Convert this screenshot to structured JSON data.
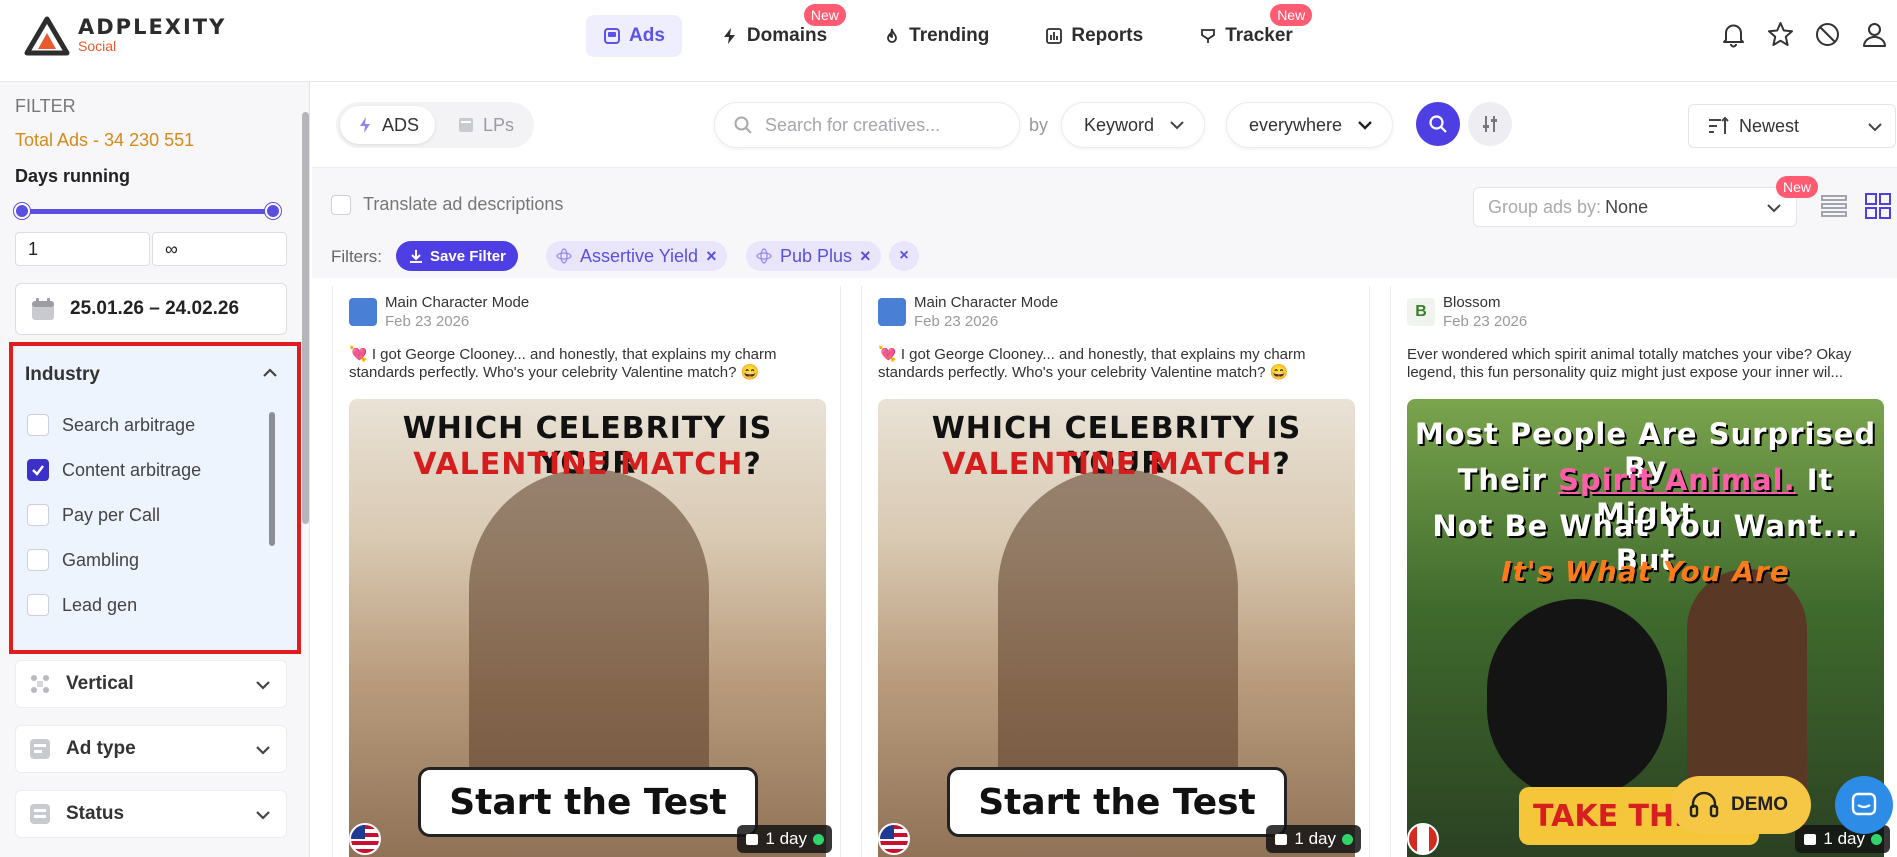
{
  "brand": {
    "name": "ADPLEXITY",
    "sub": "Social"
  },
  "nav": [
    {
      "label": "Ads",
      "icon": "ads-icon",
      "active": true,
      "badge": ""
    },
    {
      "label": "Domains",
      "icon": "bolt-icon",
      "active": false,
      "badge": "New"
    },
    {
      "label": "Trending",
      "icon": "flame-icon",
      "active": false,
      "badge": ""
    },
    {
      "label": "Reports",
      "icon": "chart-icon",
      "active": false,
      "badge": ""
    },
    {
      "label": "Tracker",
      "icon": "tracker-icon",
      "active": false,
      "badge": "New"
    }
  ],
  "top_icons": [
    "bell-icon",
    "star-icon",
    "block-icon",
    "user-icon"
  ],
  "sidebar": {
    "filter_title": "FILTER",
    "total_ads": "Total Ads - 34 230 551",
    "days_running": {
      "label": "Days running",
      "min_value": "1",
      "max_value": "∞"
    },
    "date_range": "25.01.26 – 24.02.26",
    "industry": {
      "title": "Industry",
      "options": [
        {
          "label": "Search arbitrage",
          "checked": false
        },
        {
          "label": "Content arbitrage",
          "checked": true
        },
        {
          "label": "Pay per Call",
          "checked": false
        },
        {
          "label": "Gambling",
          "checked": false
        },
        {
          "label": "Lead gen",
          "checked": false
        }
      ]
    },
    "sections": [
      {
        "label": "Vertical",
        "icon": "grid-icon"
      },
      {
        "label": "Ad type",
        "icon": "ad-type-icon"
      },
      {
        "label": "Status",
        "icon": "status-icon"
      }
    ]
  },
  "search": {
    "type_tabs": [
      {
        "label": "ADS",
        "active": true
      },
      {
        "label": "LPs",
        "active": false
      }
    ],
    "placeholder": "Search for creatives...",
    "value": "",
    "by_label": "by",
    "by_field": "Keyword",
    "scope": "everywhere",
    "sort": "Newest"
  },
  "options": {
    "translate_label": "Translate ad descriptions",
    "group_by_label": "Group ads by:",
    "group_by_value": "None",
    "group_badge": "New",
    "filters_label": "Filters:",
    "save_filter_label": "Save Filter",
    "active_filters": [
      "Assertive Yield",
      "Pub Plus"
    ],
    "remove_symbol": "×"
  },
  "cards": [
    {
      "advertiser": "Main Character Mode",
      "date": "Feb 23 2026",
      "description": "💘 I got George Clooney... and honestly, that explains my charm standards perfectly. Who's your celebrity Valentine match? 😄",
      "headline_1": "WHICH CELEBRITY IS YOUR",
      "headline_2a": "VALENTINE MATCH",
      "headline_2b": "?",
      "cta": "Start the Test",
      "country": "US",
      "days": "1 day"
    },
    {
      "advertiser": "Main Character Mode",
      "date": "Feb 23 2026",
      "description": "💘 I got George Clooney... and honestly, that explains my charm standards perfectly. Who's your celebrity Valentine match? 😄",
      "headline_1": "WHICH CELEBRITY IS YOUR",
      "headline_2a": "VALENTINE MATCH",
      "headline_2b": "?",
      "cta": "Start the Test",
      "country": "US",
      "days": "1 day"
    },
    {
      "advertiser": "Blossom",
      "avatar_letter": "B",
      "date": "Feb 23 2026",
      "description": "Ever wondered which spirit animal totally matches your vibe? Okay legend, this fun personality quiz might just expose your inner wil...",
      "headline_line_1": "Most People Are Surprised By",
      "headline_line_2a": "Their",
      "headline_line_2b": "Spirit Animal.",
      "headline_line_2c": "It Might",
      "headline_line_3": "Not Be What You Want... But",
      "headline_line_4": "It's What You Are",
      "cta": "TAKE THE",
      "country": "CA",
      "days": "1 day"
    }
  ],
  "floating": {
    "demo_label": "DEMO"
  },
  "colors": {
    "accent": "#4d3fe3",
    "brand_orange": "#e8592f",
    "new_badge": "#ff5b73",
    "highlight_border": "#e11c1c",
    "total_ads": "#d58a1a"
  }
}
